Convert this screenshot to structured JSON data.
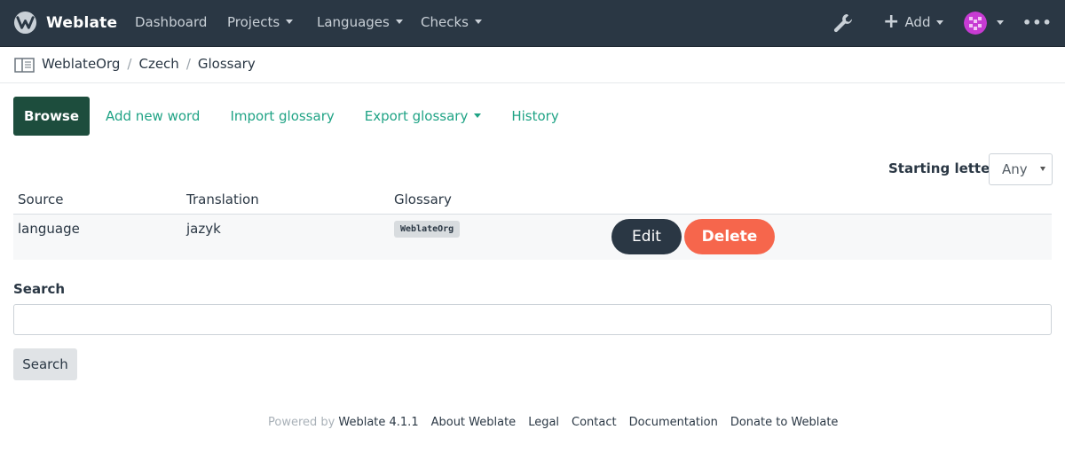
{
  "navbar": {
    "brand": "Weblate",
    "items": [
      {
        "label": "Dashboard",
        "dropdown": false
      },
      {
        "label": "Projects",
        "dropdown": true
      },
      {
        "label": "Languages",
        "dropdown": true
      },
      {
        "label": "Checks",
        "dropdown": true
      }
    ],
    "add_label": "Add",
    "icons": {
      "settings": "wrench-icon",
      "more": "more-dots-icon",
      "avatar": "user-avatar"
    }
  },
  "breadcrumb": {
    "icon": "glossary-book-icon",
    "items": [
      "WeblateOrg",
      "Czech",
      "Glossary"
    ]
  },
  "tabs": {
    "active": "Browse",
    "items": [
      "Add new word",
      "Import glossary",
      "Export glossary",
      "History"
    ]
  },
  "filter": {
    "label": "Starting letter",
    "selected": "Any"
  },
  "table": {
    "headers": [
      "Source",
      "Translation",
      "Glossary"
    ],
    "rows": [
      {
        "source": "language",
        "translation": "jazyk",
        "glossary": "WeblateOrg",
        "edit": "Edit",
        "delete": "Delete"
      }
    ]
  },
  "search": {
    "label": "Search",
    "value": "",
    "button": "Search"
  },
  "footer": {
    "powered_by": "Powered by",
    "links": [
      "Weblate 4.1.1",
      "About Weblate",
      "Legal",
      "Contact",
      "Documentation",
      "Donate to Weblate"
    ]
  },
  "colors": {
    "navbar_bg": "#2a3744",
    "accent": "#1fa385",
    "active_tab": "#1d4d3d",
    "delete": "#f6664c"
  }
}
